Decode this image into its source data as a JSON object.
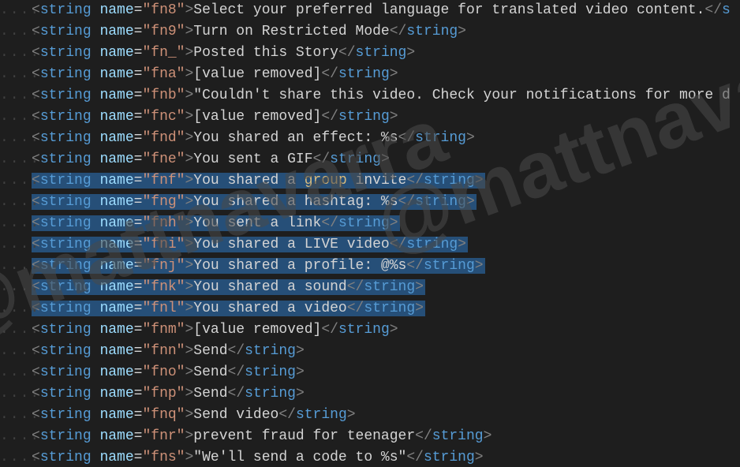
{
  "watermark": "@mattnavarra",
  "lines": [
    {
      "attr": "fn8",
      "text": "Select your preferred language for translated video content.",
      "selected": false,
      "truncated_close": true
    },
    {
      "attr": "fn9",
      "text": "Turn on Restricted Mode",
      "selected": false
    },
    {
      "attr": "fn_",
      "text": "Posted this Story",
      "selected": false
    },
    {
      "attr": "fna",
      "text": "[value removed]",
      "selected": false
    },
    {
      "attr": "fnb",
      "text": "\"Couldn't share this video. Check your notifications for more d",
      "selected": false,
      "truncated": true
    },
    {
      "attr": "fnc",
      "text": "[value removed]",
      "selected": false
    },
    {
      "attr": "fnd",
      "text": "You shared an effect: %s",
      "selected": false
    },
    {
      "attr": "fne",
      "text": "You sent a GIF",
      "selected": false
    },
    {
      "attr": "fnf",
      "text": "You shared a group invite",
      "selected": true,
      "highlight_word": "group"
    },
    {
      "attr": "fng",
      "text": "You shared a hashtag: %s",
      "selected": true
    },
    {
      "attr": "fnh",
      "text": "You sent a link",
      "selected": true
    },
    {
      "attr": "fni",
      "text": "You shared a LIVE video",
      "selected": true
    },
    {
      "attr": "fnj",
      "text": "You shared a profile: @%s",
      "selected": true
    },
    {
      "attr": "fnk",
      "text": "You shared a sound",
      "selected": true
    },
    {
      "attr": "fnl",
      "text": "You shared a video",
      "selected": true
    },
    {
      "attr": "fnm",
      "text": "[value removed]",
      "selected": false
    },
    {
      "attr": "fnn",
      "text": "Send",
      "selected": false
    },
    {
      "attr": "fno",
      "text": "Send",
      "selected": false
    },
    {
      "attr": "fnp",
      "text": "Send",
      "selected": false
    },
    {
      "attr": "fnq",
      "text": "Send video",
      "selected": false
    },
    {
      "attr": "fnr",
      "text": "prevent fraud for teenager",
      "selected": false
    },
    {
      "attr": "fns",
      "text": "\"We'll send a code to %s\"",
      "selected": false
    }
  ]
}
